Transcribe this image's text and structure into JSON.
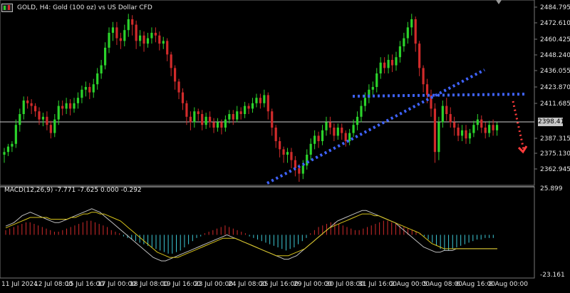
{
  "header": {
    "symbol_label": "GOLD, H4:  Gold (100 oz) vs US Dollar CFD"
  },
  "macd": {
    "label": "MACD(12,26,9) -7.771 -7.625 0.000 -0.292",
    "y_top_label": "25.899",
    "y_bottom_label": "-23.161"
  },
  "price_badge": "2398.410",
  "colors": {
    "bull": "#2bd32b",
    "bear": "#d12b2b",
    "axis": "#e6e6e6",
    "hist_pos": "#d12b2b",
    "hist_neg": "#3dc9d6",
    "macd_line": "#c0c0c0",
    "signal_line": "#d6c21a",
    "trend_blue": "#3f63ff",
    "arrow_red": "#ff3b3b"
  },
  "chart_data": {
    "type": "candlestick",
    "y_ticks": [
      "2484.795",
      "2472.610",
      "2460.425",
      "2448.240",
      "2436.055",
      "2423.870",
      "2411.685",
      "2387.315",
      "2375.130",
      "2362.945"
    ],
    "x_ticks": [
      "11 Jul 2024",
      "12 Jul 08:00",
      "15 Jul 16:00",
      "17 Jul 00:00",
      "18 Jul 08:00",
      "19 Jul 16:00",
      "23 Jul 00:00",
      "24 Jul 08:00",
      "25 Jul 16:00",
      "29 Jul 00:00",
      "30 Jul 08:00",
      "31 Jul 16:00",
      "2 Aug 00:00",
      "5 Aug 08:00",
      "6 Aug 16:00",
      "8 Aug 00:00"
    ],
    "candles": [
      [
        2376,
        2378,
        2370,
        2381
      ],
      [
        2378,
        2382,
        2375,
        2384
      ],
      [
        2382,
        2384,
        2378,
        2386
      ],
      [
        2384,
        2398,
        2381,
        2402
      ],
      [
        2398,
        2406,
        2393,
        2410
      ],
      [
        2406,
        2416,
        2402,
        2419
      ],
      [
        2416,
        2414,
        2410,
        2419
      ],
      [
        2414,
        2412,
        2406,
        2417
      ],
      [
        2412,
        2408,
        2404,
        2414
      ],
      [
        2408,
        2402,
        2398,
        2411
      ],
      [
        2402,
        2404,
        2397,
        2407
      ],
      [
        2404,
        2398,
        2394,
        2408
      ],
      [
        2398,
        2392,
        2388,
        2401
      ],
      [
        2392,
        2402,
        2389,
        2406
      ],
      [
        2402,
        2412,
        2398,
        2416
      ],
      [
        2412,
        2410,
        2405,
        2416
      ],
      [
        2410,
        2414,
        2406,
        2418
      ],
      [
        2414,
        2410,
        2405,
        2417
      ],
      [
        2410,
        2414,
        2407,
        2418
      ],
      [
        2414,
        2418,
        2410,
        2422
      ],
      [
        2418,
        2424,
        2414,
        2427
      ],
      [
        2424,
        2426,
        2419,
        2430
      ],
      [
        2426,
        2422,
        2417,
        2429
      ],
      [
        2422,
        2428,
        2418,
        2432
      ],
      [
        2428,
        2436,
        2424,
        2440
      ],
      [
        2436,
        2442,
        2432,
        2446
      ],
      [
        2442,
        2455,
        2439,
        2459
      ],
      [
        2455,
        2466,
        2451,
        2470
      ],
      [
        2466,
        2470,
        2460,
        2474
      ],
      [
        2470,
        2462,
        2457,
        2474
      ],
      [
        2462,
        2460,
        2454,
        2466
      ],
      [
        2460,
        2468,
        2456,
        2472
      ],
      [
        2468,
        2476,
        2463,
        2480
      ],
      [
        2476,
        2472,
        2464,
        2479
      ],
      [
        2472,
        2460,
        2454,
        2475
      ],
      [
        2460,
        2464,
        2456,
        2468
      ],
      [
        2464,
        2458,
        2452,
        2467
      ],
      [
        2458,
        2462,
        2455,
        2466
      ],
      [
        2462,
        2466,
        2458,
        2470
      ],
      [
        2466,
        2464,
        2459,
        2470
      ],
      [
        2464,
        2458,
        2453,
        2467
      ],
      [
        2458,
        2460,
        2454,
        2463
      ],
      [
        2460,
        2450,
        2445,
        2462
      ],
      [
        2450,
        2440,
        2434,
        2452
      ],
      [
        2440,
        2430,
        2424,
        2442
      ],
      [
        2430,
        2422,
        2417,
        2432
      ],
      [
        2422,
        2414,
        2409,
        2425
      ],
      [
        2414,
        2404,
        2398,
        2416
      ],
      [
        2404,
        2400,
        2394,
        2408
      ],
      [
        2400,
        2408,
        2396,
        2411
      ],
      [
        2408,
        2406,
        2401,
        2410
      ],
      [
        2406,
        2398,
        2394,
        2409
      ],
      [
        2398,
        2404,
        2395,
        2407
      ],
      [
        2404,
        2400,
        2396,
        2408
      ],
      [
        2400,
        2396,
        2392,
        2403
      ],
      [
        2396,
        2400,
        2393,
        2403
      ],
      [
        2400,
        2396,
        2391,
        2402
      ],
      [
        2396,
        2402,
        2393,
        2405
      ],
      [
        2402,
        2406,
        2399,
        2409
      ],
      [
        2406,
        2402,
        2398,
        2409
      ],
      [
        2402,
        2408,
        2400,
        2412
      ],
      [
        2408,
        2406,
        2402,
        2411
      ],
      [
        2406,
        2412,
        2403,
        2415
      ],
      [
        2412,
        2410,
        2406,
        2414
      ],
      [
        2410,
        2414,
        2407,
        2418
      ],
      [
        2414,
        2418,
        2411,
        2421
      ],
      [
        2418,
        2414,
        2410,
        2421
      ],
      [
        2414,
        2420,
        2411,
        2424
      ],
      [
        2420,
        2408,
        2402,
        2422
      ],
      [
        2408,
        2396,
        2390,
        2410
      ],
      [
        2396,
        2386,
        2381,
        2398
      ],
      [
        2386,
        2380,
        2374,
        2389
      ],
      [
        2380,
        2376,
        2370,
        2382
      ],
      [
        2376,
        2378,
        2370,
        2381
      ],
      [
        2378,
        2372,
        2366,
        2381
      ],
      [
        2372,
        2366,
        2360,
        2375
      ],
      [
        2366,
        2362,
        2356,
        2369
      ],
      [
        2362,
        2368,
        2358,
        2372
      ],
      [
        2368,
        2376,
        2365,
        2380
      ],
      [
        2376,
        2384,
        2372,
        2388
      ],
      [
        2384,
        2390,
        2380,
        2394
      ],
      [
        2390,
        2386,
        2381,
        2393
      ],
      [
        2386,
        2394,
        2383,
        2398
      ],
      [
        2394,
        2400,
        2390,
        2404
      ],
      [
        2400,
        2396,
        2391,
        2404
      ],
      [
        2396,
        2390,
        2386,
        2399
      ],
      [
        2390,
        2396,
        2387,
        2399
      ],
      [
        2396,
        2392,
        2387,
        2399
      ],
      [
        2392,
        2386,
        2382,
        2394
      ],
      [
        2386,
        2392,
        2383,
        2395
      ],
      [
        2392,
        2398,
        2389,
        2402
      ],
      [
        2398,
        2404,
        2394,
        2408
      ],
      [
        2404,
        2412,
        2400,
        2416
      ],
      [
        2412,
        2418,
        2408,
        2422
      ],
      [
        2418,
        2424,
        2414,
        2428
      ],
      [
        2424,
        2426,
        2420,
        2430
      ],
      [
        2426,
        2436,
        2422,
        2440
      ],
      [
        2436,
        2444,
        2432,
        2448
      ],
      [
        2444,
        2440,
        2436,
        2448
      ],
      [
        2440,
        2446,
        2436,
        2450
      ],
      [
        2446,
        2442,
        2437,
        2450
      ],
      [
        2442,
        2448,
        2438,
        2452
      ],
      [
        2448,
        2456,
        2444,
        2460
      ],
      [
        2456,
        2462,
        2452,
        2466
      ],
      [
        2462,
        2470,
        2458,
        2474
      ],
      [
        2470,
        2476,
        2464,
        2480
      ],
      [
        2476,
        2458,
        2452,
        2478
      ],
      [
        2458,
        2440,
        2434,
        2460
      ],
      [
        2440,
        2428,
        2422,
        2442
      ],
      [
        2428,
        2420,
        2414,
        2432
      ],
      [
        2420,
        2410,
        2404,
        2424
      ],
      [
        2410,
        2378,
        2370,
        2414
      ],
      [
        2378,
        2400,
        2372,
        2404
      ],
      [
        2400,
        2412,
        2396,
        2416
      ],
      [
        2412,
        2406,
        2401,
        2418
      ],
      [
        2406,
        2400,
        2396,
        2411
      ],
      [
        2400,
        2396,
        2390,
        2404
      ],
      [
        2396,
        2390,
        2386,
        2399
      ],
      [
        2390,
        2394,
        2386,
        2398
      ],
      [
        2394,
        2388,
        2384,
        2398
      ],
      [
        2388,
        2392,
        2384,
        2395
      ],
      [
        2392,
        2398,
        2389,
        2401
      ],
      [
        2398,
        2402,
        2394,
        2406
      ],
      [
        2402,
        2396,
        2392,
        2405
      ],
      [
        2396,
        2392,
        2388,
        2400
      ],
      [
        2392,
        2398,
        2389,
        2401
      ],
      [
        2398,
        2394,
        2390,
        2402
      ],
      [
        2394,
        2398,
        2390,
        2400
      ]
    ],
    "macd_hist": [
      3,
      4,
      5,
      6,
      7,
      8,
      8,
      7,
      6,
      5,
      4,
      3,
      2,
      2,
      3,
      4,
      5,
      6,
      7,
      8,
      9,
      9,
      8,
      7,
      6,
      5,
      3,
      2,
      1,
      -1,
      -2,
      -3,
      -4,
      -5,
      -6,
      -7,
      -8,
      -9,
      -10,
      -11,
      -12,
      -12,
      -11,
      -10,
      -8,
      -6,
      -4,
      -2,
      -1,
      1,
      2,
      3,
      4,
      5,
      6,
      5,
      4,
      3,
      2,
      1,
      -1,
      -2,
      -3,
      -4,
      -5,
      -6,
      -7,
      -8,
      -9,
      -10,
      -9,
      -8,
      -6,
      -4,
      -2,
      1,
      3,
      5,
      6,
      7,
      8,
      8,
      7,
      6,
      5,
      4,
      3,
      3,
      4,
      5,
      6,
      7,
      8,
      9,
      9,
      8,
      7,
      6,
      5,
      4,
      3,
      2,
      1,
      -1,
      -3,
      -5,
      -7,
      -9,
      -10,
      -10,
      -9,
      -8,
      -7,
      -6,
      -5,
      -4,
      -3,
      -3,
      -2,
      -2,
      -2
    ],
    "macd_line": [
      5,
      6,
      7,
      9,
      11,
      12,
      13,
      12,
      11,
      10,
      9,
      8,
      7,
      7,
      8,
      9,
      10,
      11,
      12,
      13,
      14,
      15,
      14,
      13,
      11,
      9,
      7,
      5,
      3,
      1,
      -1,
      -3,
      -5,
      -7,
      -9,
      -11,
      -13,
      -14,
      -15,
      -15,
      -14,
      -13,
      -12,
      -11,
      -10,
      -9,
      -8,
      -7,
      -6,
      -5,
      -4,
      -3,
      -2,
      -1,
      0,
      -1,
      -2,
      -3,
      -4,
      -5,
      -6,
      -7,
      -8,
      -9,
      -10,
      -11,
      -12,
      -13,
      -14,
      -14,
      -13,
      -12,
      -10,
      -8,
      -6,
      -4,
      -2,
      0,
      2,
      4,
      6,
      8,
      9,
      10,
      11,
      12,
      13,
      14,
      14,
      13,
      12,
      11,
      10,
      9,
      8,
      7,
      5,
      3,
      1,
      -1,
      -3,
      -5,
      -7,
      -8,
      -9,
      -10,
      -10,
      -9,
      -9,
      -9,
      -8,
      -8,
      -8,
      -8,
      -8,
      -8,
      -8,
      -8,
      -8,
      -8,
      -8
    ],
    "signal_line": [
      4,
      5,
      6,
      7,
      8,
      9,
      10,
      10,
      10,
      10,
      10,
      9,
      9,
      9,
      9,
      9,
      10,
      10,
      11,
      12,
      12,
      13,
      13,
      12,
      12,
      11,
      10,
      9,
      8,
      6,
      4,
      2,
      0,
      -2,
      -4,
      -6,
      -8,
      -10,
      -11,
      -12,
      -13,
      -13,
      -13,
      -12,
      -11,
      -10,
      -9,
      -8,
      -7,
      -6,
      -5,
      -4,
      -3,
      -2,
      -2,
      -2,
      -2,
      -3,
      -4,
      -5,
      -6,
      -7,
      -8,
      -9,
      -10,
      -11,
      -12,
      -12,
      -12,
      -12,
      -11,
      -10,
      -9,
      -8,
      -6,
      -4,
      -2,
      0,
      2,
      4,
      5,
      6,
      7,
      8,
      9,
      10,
      11,
      12,
      12,
      12,
      11,
      11,
      10,
      9,
      8,
      7,
      6,
      5,
      4,
      3,
      2,
      1,
      -1,
      -3,
      -5,
      -6,
      -7,
      -8,
      -8,
      -8,
      -8,
      -8,
      -8,
      -8,
      -8,
      -8,
      -8,
      -8,
      -8,
      -8,
      -8
    ]
  }
}
